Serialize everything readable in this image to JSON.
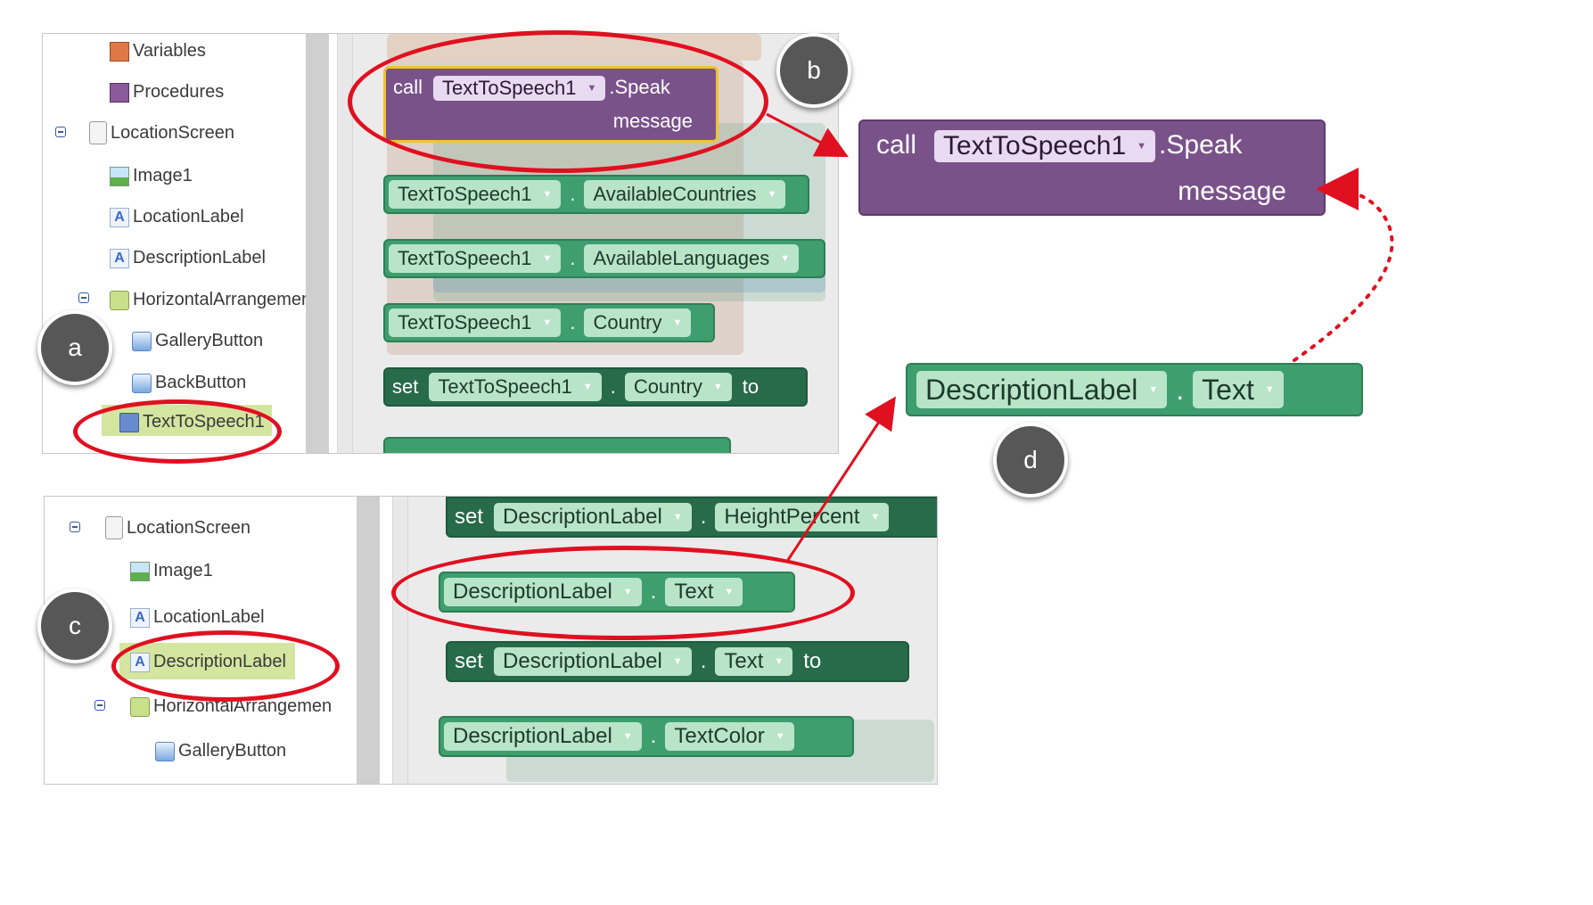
{
  "top_panel": {
    "tree": [
      {
        "label": "Variables",
        "icon": "variables-icon"
      },
      {
        "label": "Procedures",
        "icon": "procedures-icon"
      },
      {
        "label": "LocationScreen",
        "icon": "screen-icon"
      },
      {
        "label": "Image1",
        "icon": "image-icon"
      },
      {
        "label": "LocationLabel",
        "icon": "label-icon"
      },
      {
        "label": "DescriptionLabel",
        "icon": "label-icon"
      },
      {
        "label": "HorizontalArrangemer",
        "icon": "horizontal-arrangement-icon"
      },
      {
        "label": "GalleryButton",
        "icon": "button-icon"
      },
      {
        "label": "BackButton",
        "icon": "button-icon"
      },
      {
        "label": "TextToSpeech1",
        "icon": "text-to-speech-icon"
      }
    ],
    "blocks": {
      "call": {
        "kw": "call",
        "component": "TextToSpeech1",
        "method": ".Speak",
        "arg": "message"
      },
      "countries": {
        "component": "TextToSpeech1",
        "dot": ".",
        "prop": "AvailableCountries"
      },
      "languages": {
        "component": "TextToSpeech1",
        "dot": ".",
        "prop": "AvailableLanguages"
      },
      "country": {
        "component": "TextToSpeech1",
        "dot": ".",
        "prop": "Country"
      },
      "set_country": {
        "kw": "set",
        "component": "TextToSpeech1",
        "dot": ".",
        "prop": "Country",
        "to": "to"
      }
    }
  },
  "bottom_panel": {
    "tree": [
      {
        "label": "LocationScreen",
        "icon": "screen-icon"
      },
      {
        "label": "Image1",
        "icon": "image-icon"
      },
      {
        "label": "LocationLabel",
        "icon": "label-icon"
      },
      {
        "label": "DescriptionLabel",
        "icon": "label-icon"
      },
      {
        "label": "HorizontalArrangemen",
        "icon": "horizontal-arrangement-icon"
      },
      {
        "label": "GalleryButton",
        "icon": "button-icon"
      }
    ],
    "blocks": {
      "set_height": {
        "kw": "set",
        "component": "DescriptionLabel",
        "dot": ".",
        "prop": "HeightPercent"
      },
      "get_text": {
        "component": "DescriptionLabel",
        "dot": ".",
        "prop": "Text"
      },
      "set_text": {
        "kw": "set",
        "component": "DescriptionLabel",
        "dot": ".",
        "prop": "Text",
        "to": "to"
      },
      "text_color": {
        "component": "DescriptionLabel",
        "dot": ".",
        "prop": "TextColor"
      }
    }
  },
  "zoom_call": {
    "kw": "call",
    "component": "TextToSpeech1",
    "method": ".Speak",
    "arg": "message"
  },
  "zoom_get": {
    "component": "DescriptionLabel",
    "dot": ".",
    "prop": "Text"
  },
  "badges": {
    "a": "a",
    "b": "b",
    "c": "c",
    "d": "d"
  },
  "colors": {
    "highlight": "#e01020",
    "purple_block": "#7a528a",
    "green_block": "#3e9e6e",
    "dark_green_block": "#276b4b"
  }
}
